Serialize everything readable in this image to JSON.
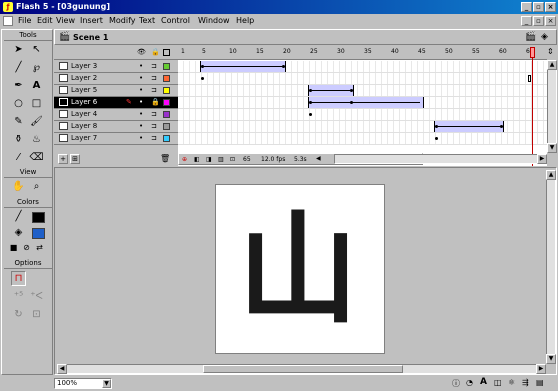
{
  "window": {
    "title": "Flash 5 - [03gunung]",
    "minimize": "_",
    "maximize": "▫",
    "close": "×"
  },
  "menu": [
    "File",
    "Edit",
    "View",
    "Insert",
    "Modify",
    "Text",
    "Control",
    "Window",
    "Help"
  ],
  "tools_panel": {
    "header": "Tools",
    "view_header": "View",
    "colors_header": "Colors",
    "options_header": "Options",
    "stroke_color": "#000000",
    "fill_color": "#1e5fc8"
  },
  "scene": {
    "label": "Scene 1"
  },
  "timeline": {
    "frame_ruler": [
      "1",
      "5",
      "10",
      "15",
      "20",
      "25",
      "30",
      "35",
      "40",
      "45",
      "50",
      "55",
      "60",
      "65"
    ],
    "current_frame": "65",
    "frame_rate": "12.0 fps",
    "elapsed": "5.3s",
    "layers": [
      {
        "name": "Layer 3",
        "color": "#66cc33"
      },
      {
        "name": "Layer 2",
        "color": "#ff6633"
      },
      {
        "name": "Layer 5",
        "color": "#ffff00"
      },
      {
        "name": "Layer 6",
        "color": "#ff00ff",
        "selected": true
      },
      {
        "name": "Layer 4",
        "color": "#9933cc"
      },
      {
        "name": "Layer 8",
        "color": "#999999"
      },
      {
        "name": "Layer 7",
        "color": "#33ccff"
      }
    ]
  },
  "stage": {
    "glyph": "山"
  },
  "status": {
    "zoom": "100%"
  }
}
